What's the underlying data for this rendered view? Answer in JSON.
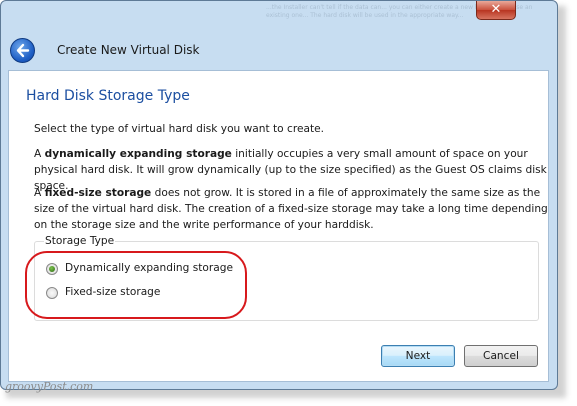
{
  "window": {
    "close_glyph": "✕",
    "background_text": "...the Installer can't tell if the data can... you can either create a new hard disk or use an existing one... The hard disk will be used in the appropriate way..."
  },
  "header": {
    "title": "Create New Virtual Disk"
  },
  "page": {
    "heading": "Hard Disk Storage Type",
    "intro": "Select the type of virtual hard disk you want to create.",
    "dynamic_para": {
      "bold": "dynamically expanding storage",
      "prefix": "A ",
      "rest": " initially occupies a very small amount of space on your physical hard disk. It will grow dynamically (up to the size specified) as the Guest OS claims disk space."
    },
    "fixed_para": {
      "prefix": "A ",
      "bold": "fixed-size storage",
      "rest": " does not grow. It is stored in a file of approximately the same size as the size of the virtual hard disk. The creation of a fixed-size storage may take a long time depending on the storage size and the write performance of your harddisk."
    }
  },
  "storage_type": {
    "label": "Storage Type",
    "options": [
      {
        "label": "Dynamically expanding storage",
        "selected": true
      },
      {
        "label": "Fixed-size storage",
        "selected": false
      }
    ]
  },
  "buttons": {
    "next": "Next",
    "cancel": "Cancel"
  },
  "watermark": "groovyPost.com",
  "colors": {
    "heading": "#1c4fa1",
    "highlight": "#d7191c",
    "chrome": "#c7ddf1"
  }
}
